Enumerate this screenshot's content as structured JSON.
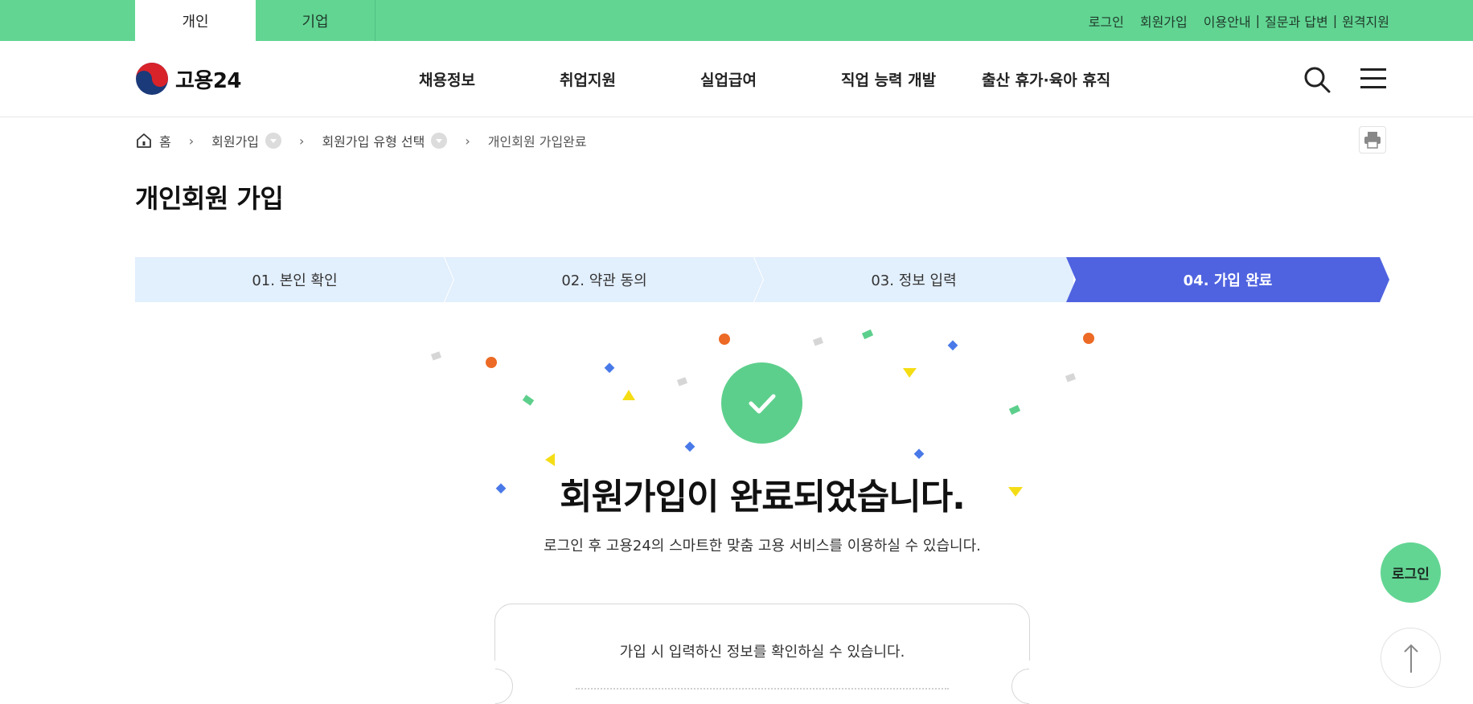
{
  "topbar": {
    "tabs": [
      {
        "label": "개인"
      },
      {
        "label": "기업"
      }
    ],
    "utils": {
      "login": "로그인",
      "signup": "회원가입",
      "guide": "이용안내",
      "qna": "질문과 답변",
      "remote": "원격지원",
      "separator": "|"
    }
  },
  "header": {
    "logo_text": "고용24",
    "menu": [
      "채용정보",
      "취업지원",
      "실업급여",
      "직업 능력 개발",
      "출산 휴가·육아 휴직"
    ],
    "icons": {
      "search": "search-icon",
      "menu": "hamburger-menu-icon",
      "home": "home-icon",
      "print": "printer-icon"
    }
  },
  "breadcrumb": {
    "home": "홈",
    "items": [
      "회원가입",
      "회원가입 유형 선택",
      "개인회원 가입완료"
    ],
    "chevron": "›"
  },
  "page_title": "개인회원 가입",
  "steps": [
    {
      "label": "01. 본인 확인",
      "active": false
    },
    {
      "label": "02. 약관 동의",
      "active": false
    },
    {
      "label": "03. 정보 입력",
      "active": false
    },
    {
      "label": "04. 가입 완료",
      "active": true
    }
  ],
  "colors": {
    "brand_green": "#62d593",
    "step_inactive": "#e2effd",
    "step_active": "#4f63e0",
    "check_green": "#5dcf8c"
  },
  "completion": {
    "title": "회원가입이 완료되었습니다.",
    "description": "로그인 후 고용24의 스마트한 맞춤 고용 서비스를 이용하실 수 있습니다.",
    "card_text": "가입 시 입력하신 정보를 확인하실 수 있습니다."
  },
  "floating": {
    "login": "로그인"
  }
}
